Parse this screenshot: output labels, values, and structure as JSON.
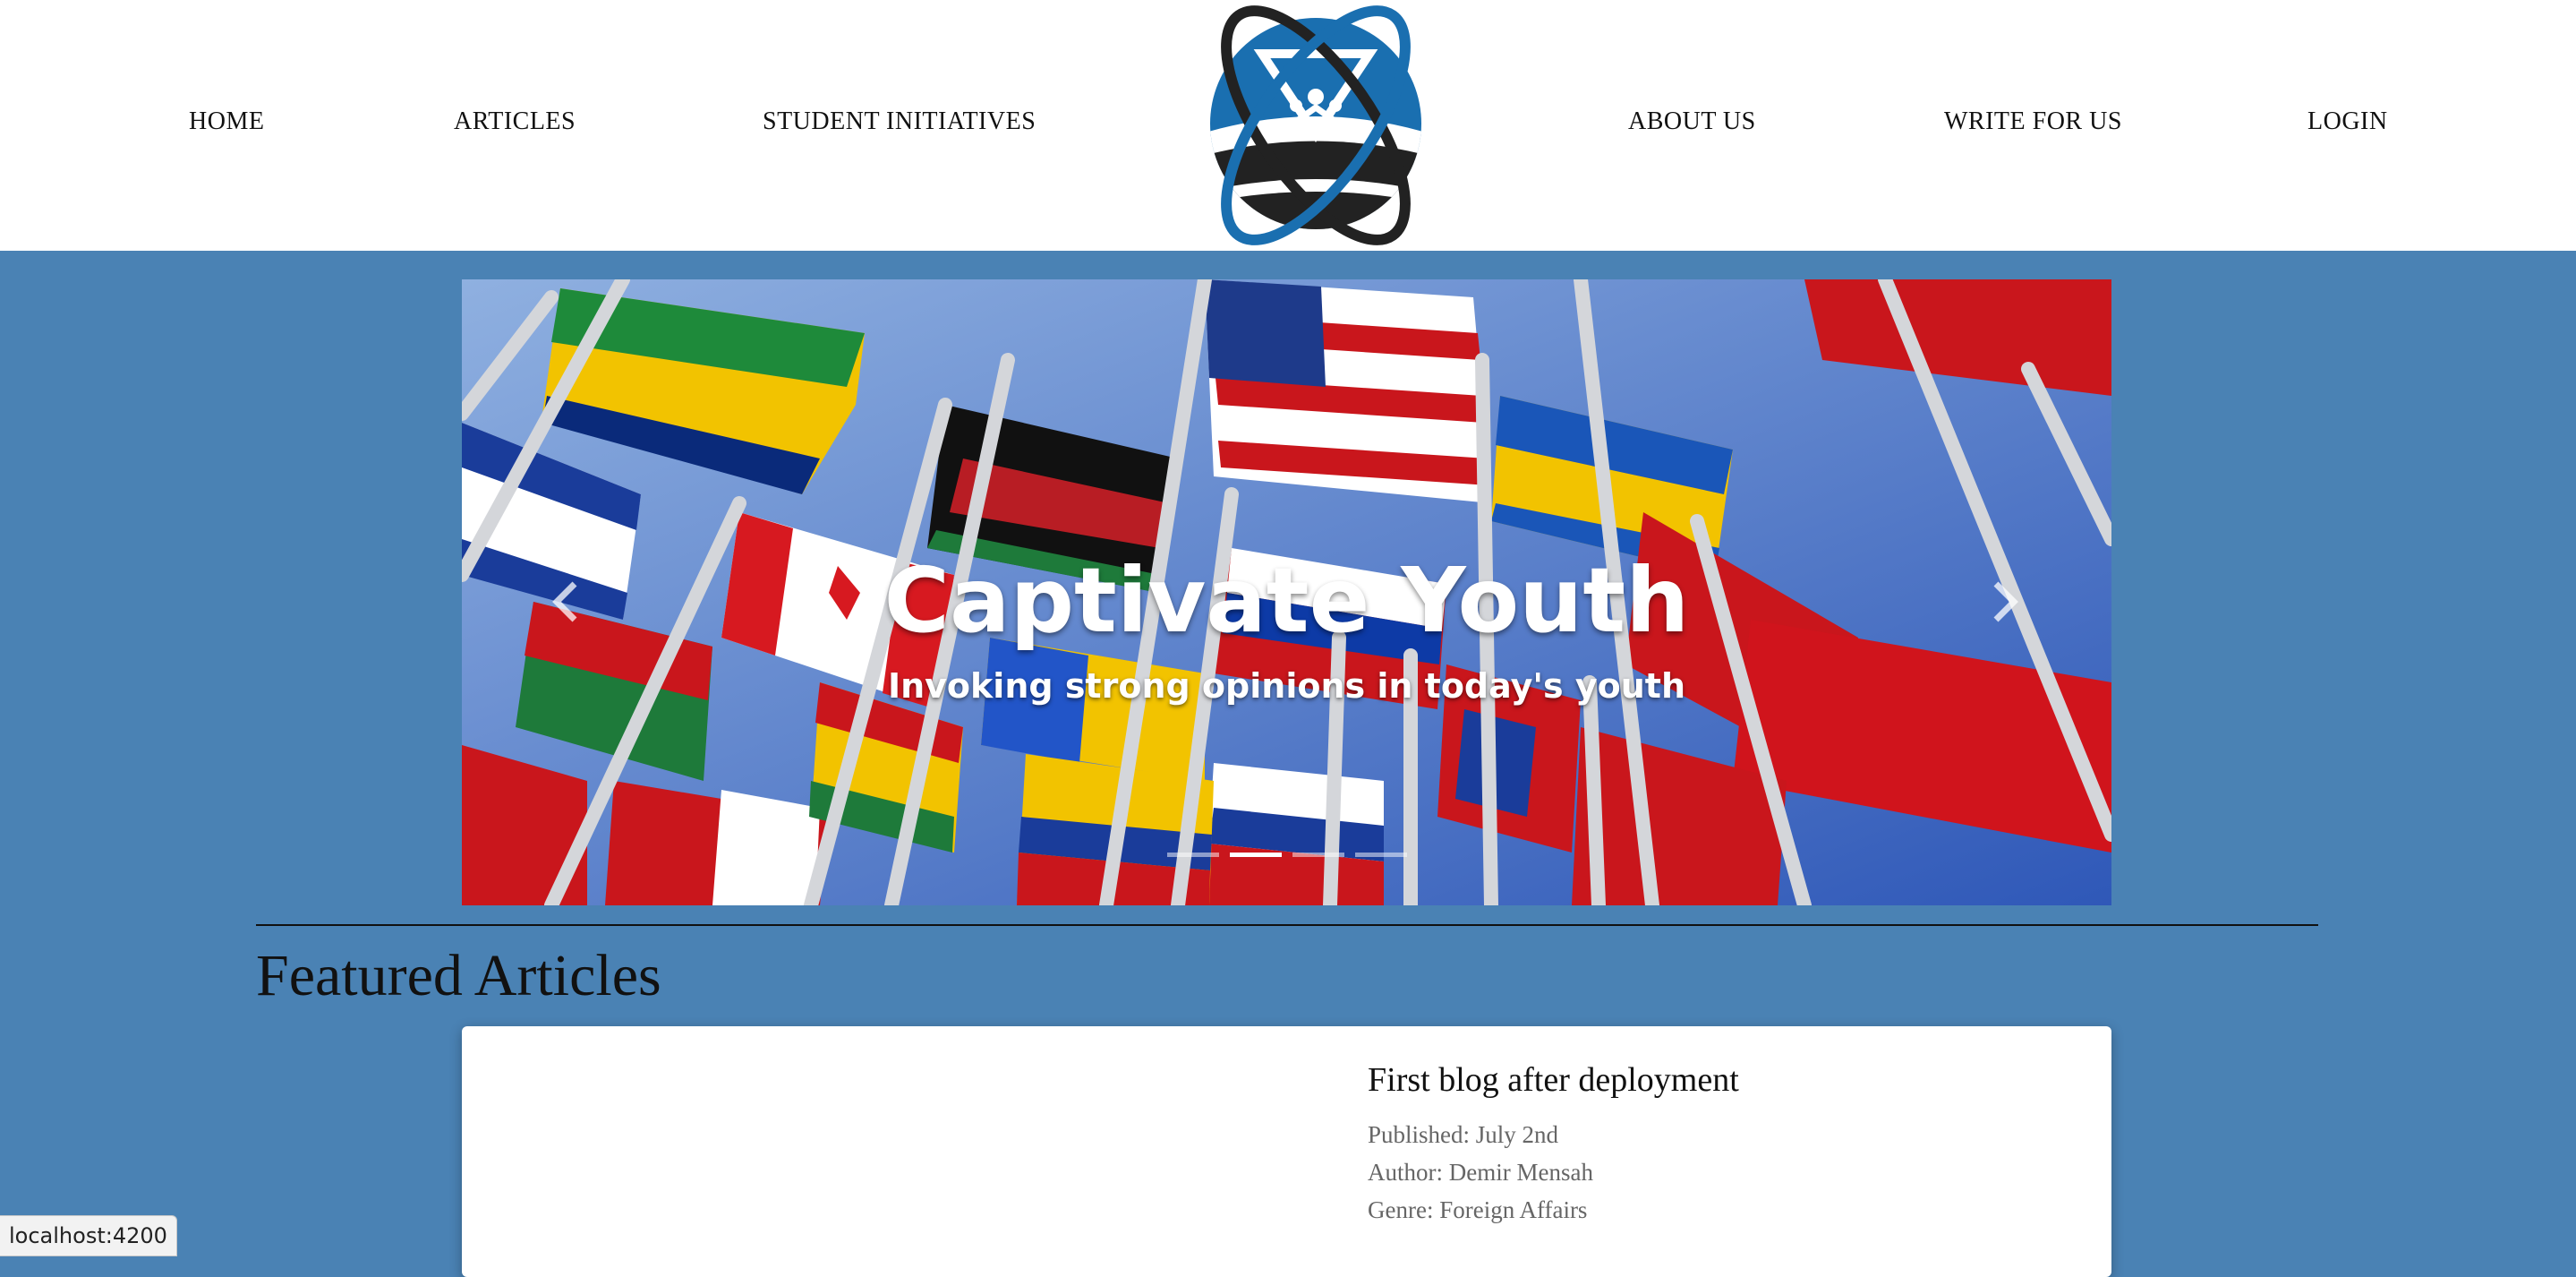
{
  "nav": {
    "left": [
      "HOME",
      "ARTICLES",
      "STUDENT INITIATIVES"
    ],
    "right": [
      "ABOUT US",
      "WRITE FOR US",
      "LOGIN"
    ]
  },
  "logo": {
    "icon": "globe-orbit-logo-icon",
    "colors": [
      "#1a6fb0",
      "#222222"
    ]
  },
  "carousel": {
    "title": "Captivate Youth",
    "subtitle": "Invoking strong opinions in today's youth",
    "slide_count": 4,
    "active_slide": 2,
    "prev_icon": "chevron-left-icon",
    "next_icon": "chevron-right-icon"
  },
  "section": {
    "title": "Featured Articles"
  },
  "featured": [
    {
      "title": "First blog after deployment",
      "published": "Published: July 2nd",
      "author": "Author: Demir Mensah",
      "genre": "Genre: Foreign Affairs"
    }
  ],
  "status_bar": {
    "url": "localhost:4200"
  },
  "colors": {
    "background": "#4a82b4",
    "header": "#ffffff",
    "accent": "#1a6fb0"
  }
}
